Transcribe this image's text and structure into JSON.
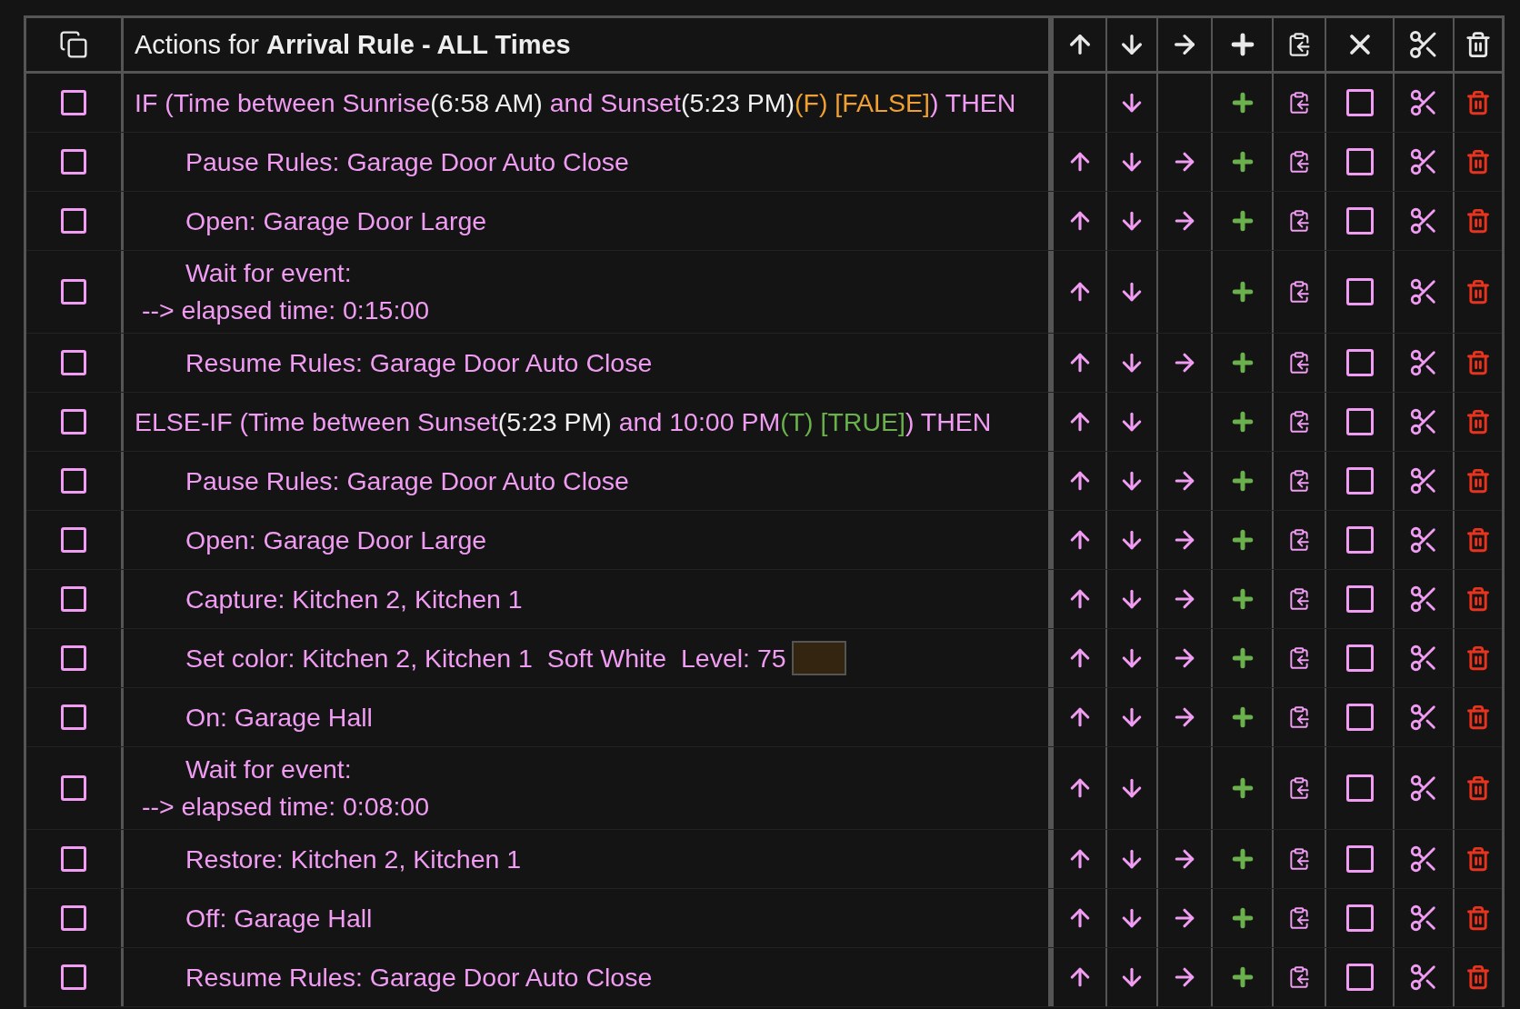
{
  "header": {
    "title": "Actions for **Arrival Rule - ALL Times**"
  },
  "actions": [
    {
      "checked": false,
      "disabled": false,
      "can_up": false,
      "can_down": true,
      "can_indent": false,
      "lines": [
        [
          {
            "text": "IF (Time between Sunrise",
            "color": "#f09cf2"
          },
          {
            "text": "(6:58 AM)",
            "color": "#f2f2f2"
          },
          {
            "text": " and Sunset",
            "color": "#f09cf2"
          },
          {
            "text": "(5:23 PM)",
            "color": "#f2f2f2"
          },
          {
            "text": "(F) [FALSE]",
            "color": "#f0a030"
          },
          {
            "text": ") THEN",
            "color": "#f09cf2"
          }
        ]
      ],
      "children": [
        {
          "checked": false,
          "disabled": false,
          "can_up": true,
          "can_down": true,
          "can_indent": true,
          "lines": [
            [
              {
                "text": "Pause Rules: Garage Door Auto Close",
                "color": "#f09cf2"
              }
            ]
          ]
        },
        {
          "checked": false,
          "disabled": false,
          "can_up": true,
          "can_down": true,
          "can_indent": true,
          "lines": [
            [
              {
                "text": "Open: Garage Door Large",
                "color": "#f09cf2"
              }
            ]
          ]
        },
        {
          "checked": false,
          "disabled": false,
          "can_up": true,
          "can_down": true,
          "can_indent": false,
          "lines": [
            [
              {
                "text": "Wait for event:",
                "color": "#f09cf2"
              }
            ],
            [
              {
                "text": "--> elapsed time: 0:15:00",
                "color": "#f09cf2"
              }
            ]
          ]
        },
        {
          "checked": false,
          "disabled": false,
          "can_up": true,
          "can_down": true,
          "can_indent": true,
          "lines": [
            [
              {
                "text": "Resume Rules: Garage Door Auto Close",
                "color": "#f09cf2"
              }
            ]
          ]
        }
      ]
    },
    {
      "checked": false,
      "disabled": false,
      "can_up": true,
      "can_down": true,
      "can_indent": false,
      "lines": [
        [
          {
            "text": "ELSE-IF (Time between Sunset",
            "color": "#f09cf2"
          },
          {
            "text": "(5:23 PM)",
            "color": "#f2f2f2"
          },
          {
            "text": " and 10:00 PM",
            "color": "#f09cf2"
          },
          {
            "text": "(T) [TRUE]",
            "color": "#6ab04c"
          },
          {
            "text": ") THEN",
            "color": "#f09cf2"
          }
        ]
      ],
      "children": [
        {
          "checked": false,
          "disabled": false,
          "can_up": true,
          "can_down": true,
          "can_indent": true,
          "lines": [
            [
              {
                "text": "Pause Rules: Garage Door Auto Close",
                "color": "#f09cf2"
              }
            ]
          ]
        },
        {
          "checked": false,
          "disabled": false,
          "can_up": true,
          "can_down": true,
          "can_indent": true,
          "lines": [
            [
              {
                "text": "Open: Garage Door Large",
                "color": "#f09cf2"
              }
            ]
          ]
        },
        {
          "checked": false,
          "disabled": false,
          "can_up": true,
          "can_down": true,
          "can_indent": true,
          "lines": [
            [
              {
                "text": "Capture: Kitchen 2, Kitchen 1",
                "color": "#f09cf2"
              }
            ]
          ]
        },
        {
          "checked": false,
          "disabled": false,
          "can_up": true,
          "can_down": true,
          "can_indent": true,
          "lines": [
            [
              {
                "text": "Set color: Kitchen 2, Kitchen 1  Soft White  Level: 75",
                "color": "#f09cf2"
              }
            ]
          ],
          "swatch": {
            "color": "#33250f"
          }
        },
        {
          "checked": false,
          "disabled": false,
          "can_up": true,
          "can_down": true,
          "can_indent": true,
          "lines": [
            [
              {
                "text": "On: Garage Hall",
                "color": "#f09cf2"
              }
            ]
          ]
        },
        {
          "checked": false,
          "disabled": false,
          "can_up": true,
          "can_down": true,
          "can_indent": false,
          "lines": [
            [
              {
                "text": "Wait for event:",
                "color": "#f09cf2"
              }
            ],
            [
              {
                "text": "--> elapsed time: 0:08:00",
                "color": "#f09cf2"
              }
            ]
          ]
        },
        {
          "checked": false,
          "disabled": false,
          "can_up": true,
          "can_down": true,
          "can_indent": true,
          "lines": [
            [
              {
                "text": "Restore: Kitchen 2, Kitchen 1",
                "color": "#f09cf2"
              }
            ]
          ]
        },
        {
          "checked": false,
          "disabled": false,
          "can_up": true,
          "can_down": true,
          "can_indent": true,
          "lines": [
            [
              {
                "text": "Off: Garage Hall",
                "color": "#f09cf2"
              }
            ]
          ]
        },
        {
          "checked": false,
          "disabled": false,
          "can_up": true,
          "can_down": true,
          "can_indent": true,
          "lines": [
            [
              {
                "text": "Resume Rules: Garage Door Auto Close",
                "color": "#f09cf2"
              }
            ]
          ]
        }
      ]
    }
  ]
}
